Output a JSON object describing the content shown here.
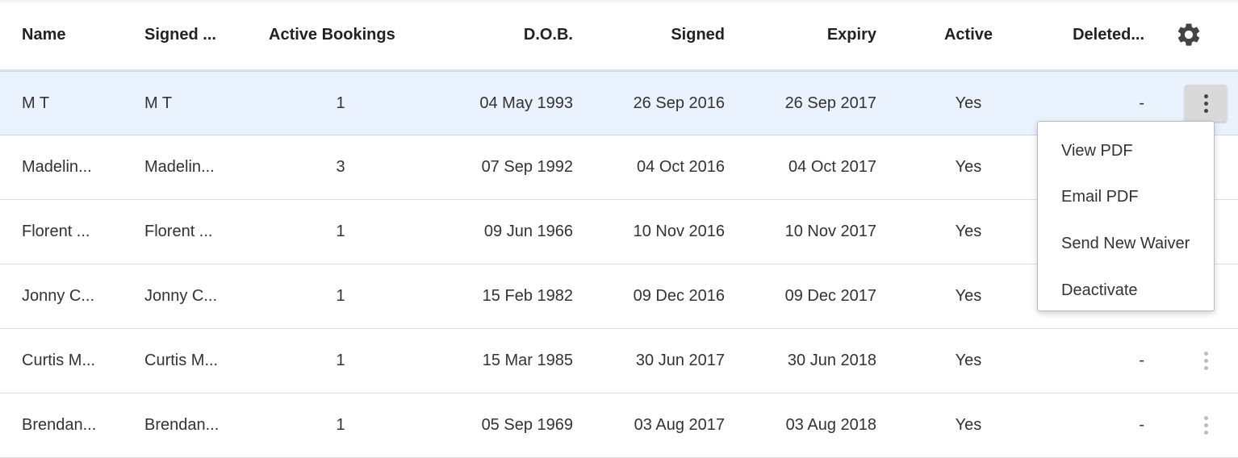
{
  "columns": {
    "name": "Name",
    "signed_by": "Signed ...",
    "active_bookings": "Active Bookings",
    "dob": "D.O.B.",
    "signed": "Signed",
    "expiry": "Expiry",
    "active": "Active",
    "deleted": "Deleted...",
    "settings_icon": "gear-icon"
  },
  "rows": [
    {
      "name": "M T",
      "signed_by": "M T",
      "bookings": "1",
      "dob": "04 May 1993",
      "signed": "26 Sep 2016",
      "expiry": "26 Sep 2017",
      "active": "Yes",
      "deleted": "-",
      "selected": true
    },
    {
      "name": "Madelin...",
      "signed_by": "Madelin...",
      "bookings": "3",
      "dob": "07 Sep 1992",
      "signed": "04 Oct 2016",
      "expiry": "04 Oct 2017",
      "active": "Yes",
      "deleted": "",
      "selected": false
    },
    {
      "name": "Florent ...",
      "signed_by": "Florent ...",
      "bookings": "1",
      "dob": "09 Jun 1966",
      "signed": "10 Nov 2016",
      "expiry": "10 Nov 2017",
      "active": "Yes",
      "deleted": "",
      "selected": false
    },
    {
      "name": "Jonny C...",
      "signed_by": "Jonny C...",
      "bookings": "1",
      "dob": "15 Feb 1982",
      "signed": "09 Dec 2016",
      "expiry": "09 Dec 2017",
      "active": "Yes",
      "deleted": "",
      "selected": false
    },
    {
      "name": "Curtis M...",
      "signed_by": "Curtis M...",
      "bookings": "1",
      "dob": "15 Mar 1985",
      "signed": "30 Jun 2017",
      "expiry": "30 Jun 2018",
      "active": "Yes",
      "deleted": "-",
      "selected": false
    },
    {
      "name": "Brendan...",
      "signed_by": "Brendan...",
      "bookings": "1",
      "dob": "05 Sep 1969",
      "signed": "03 Aug 2017",
      "expiry": "03 Aug 2018",
      "active": "Yes",
      "deleted": "-",
      "selected": false
    }
  ],
  "row_action_icon": "more-vertical-icon",
  "menu": {
    "items": [
      "View PDF",
      "Email PDF",
      "Send New Waiver",
      "Deactivate"
    ]
  },
  "colors": {
    "selected_row": "#e9f2fd",
    "divider": "#e0e0e0",
    "icon": "#444444"
  }
}
